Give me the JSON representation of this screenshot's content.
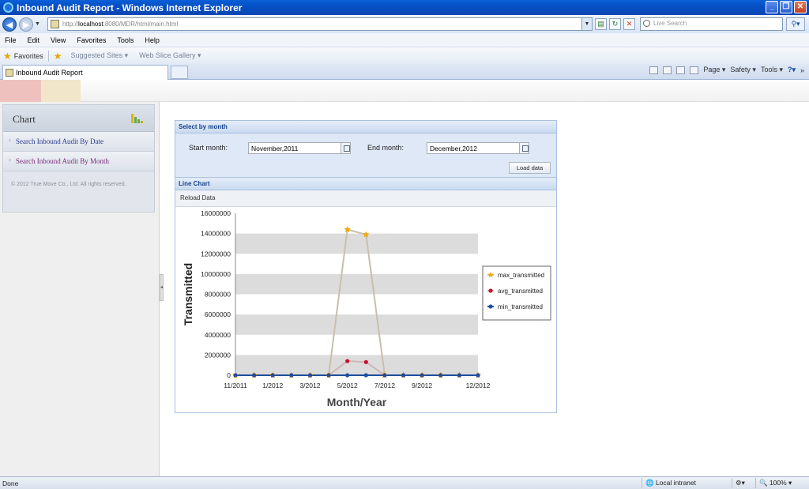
{
  "window": {
    "title": "Inbound Audit Report - Windows Internet Explorer"
  },
  "address": {
    "prefix": "http://",
    "host": "localhost",
    "path": ":8080/MDR/html/main.html"
  },
  "search": {
    "placeholder": "Live Search"
  },
  "menu": [
    "File",
    "Edit",
    "View",
    "Favorites",
    "Tools",
    "Help"
  ],
  "favorites_bar": {
    "favorites": "Favorites",
    "suggested": "Suggested Sites ▾",
    "webslice": "Web Slice Gallery ▾"
  },
  "tab": {
    "title": "Inbound Audit Report"
  },
  "commands": {
    "page": "Page ▾",
    "safety": "Safety ▾",
    "tools": "Tools ▾",
    "more": "»"
  },
  "sidebar": {
    "header": "Chart",
    "items": [
      {
        "label": "Search Inbound Audit By Date"
      },
      {
        "label": "Search Inbound Audit By Month"
      }
    ],
    "copyright": "© 2012 True Move Co., Ltd. All rights reserved."
  },
  "select_month": {
    "header": "Select by month",
    "start_label": "Start month:",
    "start_value": "November,2011",
    "end_label": "End month:",
    "end_value": "December,2012",
    "load_button": "Load data"
  },
  "line_chart": {
    "header": "Line Chart",
    "reload": "Reload Data"
  },
  "status": {
    "text": "Done",
    "zone": "Local intranet",
    "zoom": "100% ▾"
  },
  "chart_data": {
    "type": "line",
    "xlabel": "Month/Year",
    "ylabel": "Transmitted",
    "ylim": [
      0,
      16000000
    ],
    "yticks": [
      0,
      2000000,
      4000000,
      6000000,
      8000000,
      10000000,
      12000000,
      14000000,
      16000000
    ],
    "x": [
      "11/2011",
      "12/2011",
      "1/2012",
      "2/2012",
      "3/2012",
      "4/2012",
      "5/2012",
      "6/2012",
      "7/2012",
      "8/2012",
      "9/2012",
      "10/2012",
      "11/2012",
      "12/2012"
    ],
    "xtick_labels": [
      "11/2011",
      "1/2012",
      "3/2012",
      "5/2012",
      "7/2012",
      "9/2012",
      "12/2012"
    ],
    "legend_position": "right",
    "series": [
      {
        "name": "max_transmitted",
        "color": "#f2a900",
        "line_color": "#c9bfae",
        "marker": "star",
        "values": [
          0,
          0,
          0,
          0,
          0,
          0,
          14400000,
          13900000,
          0,
          0,
          0,
          0,
          0,
          0
        ]
      },
      {
        "name": "avg_transmitted",
        "color": "#c8102e",
        "line_color": "#cfb7b7",
        "marker": "circle",
        "values": [
          0,
          0,
          0,
          0,
          0,
          0,
          1400000,
          1300000,
          0,
          0,
          0,
          0,
          0,
          0
        ]
      },
      {
        "name": "min_transmitted",
        "color": "#1f4e9e",
        "line_color": "#1f4e9e",
        "marker": "circle",
        "values": [
          0,
          0,
          0,
          0,
          0,
          0,
          0,
          0,
          0,
          0,
          0,
          0,
          0,
          0
        ]
      }
    ]
  }
}
